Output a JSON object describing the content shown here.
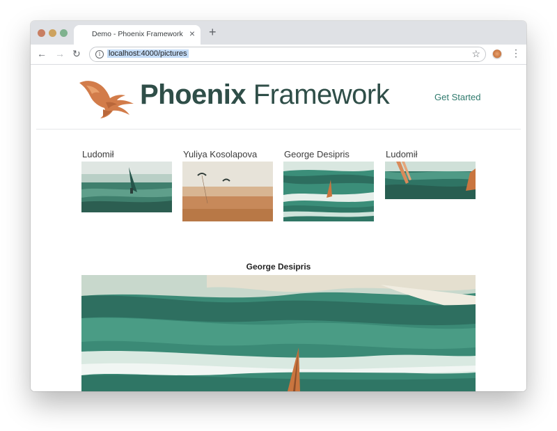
{
  "browser": {
    "tab_title": "Demo - Phoenix Framework",
    "tab_close": "×",
    "new_tab": "+",
    "url": "localhost:4000/pictures",
    "back": "←",
    "forward": "→",
    "reload": "↻",
    "info": "i",
    "bookmark": "☆",
    "menu": "⋮"
  },
  "header": {
    "logo_bold": "Phoenix",
    "logo_light": " Framework",
    "nav_link": "Get Started"
  },
  "gallery": {
    "items": [
      {
        "author": "Ludomił"
      },
      {
        "author": "Yuliya Kosolapova"
      },
      {
        "author": "George Desipris"
      },
      {
        "author": "Ludomił"
      }
    ]
  },
  "selected": {
    "author": "George Desipris"
  },
  "colors": {
    "brand_dark": "#2f4e48",
    "brand_orange": "#d27c4a",
    "link": "#2f7a6d",
    "sea": "#3e8f7c"
  }
}
